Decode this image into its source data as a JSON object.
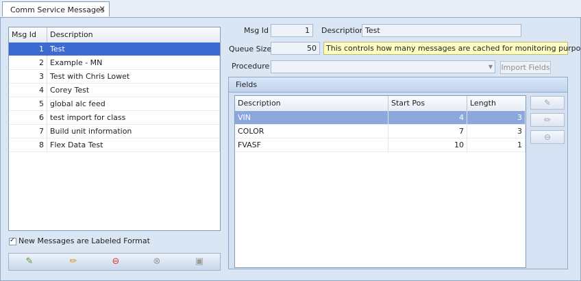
{
  "tab": {
    "title": "Comm Service Messages",
    "close": "✕"
  },
  "messages": {
    "columns": [
      "Msg Id",
      "Description"
    ],
    "rows": [
      {
        "id": "1",
        "desc": "Test"
      },
      {
        "id": "2",
        "desc": "Example - MN"
      },
      {
        "id": "3",
        "desc": "Test with Chris Lowet"
      },
      {
        "id": "4",
        "desc": "Corey Test"
      },
      {
        "id": "5",
        "desc": "global alc feed"
      },
      {
        "id": "6",
        "desc": "test import for class"
      },
      {
        "id": "7",
        "desc": "Build unit information"
      },
      {
        "id": "8",
        "desc": "Flex Data Test"
      }
    ],
    "selected_index": 0
  },
  "labeled_format": {
    "label": "New Messages are Labeled Format",
    "checked": true
  },
  "toolbar_icons": [
    "add-icon",
    "edit-icon",
    "delete-icon",
    "cancel-icon",
    "save-icon"
  ],
  "form": {
    "msg_id_label": "Msg Id",
    "msg_id_value": "1",
    "description_label": "Description",
    "description_value": "Test",
    "queue_size_label": "Queue Size",
    "queue_size_value": "50",
    "queue_hint": "This controls how many messages are cached for monitoring purposes.",
    "procedure_label": "Procedure",
    "procedure_value": "",
    "import_fields_label": "Import Fields"
  },
  "fields": {
    "group_title": "Fields",
    "columns": [
      "Description",
      "Start Pos",
      "Length"
    ],
    "rows": [
      {
        "desc": "VIN",
        "start": "4",
        "length": "3"
      },
      {
        "desc": "COLOR",
        "start": "7",
        "length": "3"
      },
      {
        "desc": "FVASF",
        "start": "10",
        "length": "1"
      }
    ],
    "selected_index": 0
  },
  "colors": {
    "selection": "#3c6ad0",
    "panel": "#dbe6f4",
    "hint_bg": "#ffffc4"
  }
}
